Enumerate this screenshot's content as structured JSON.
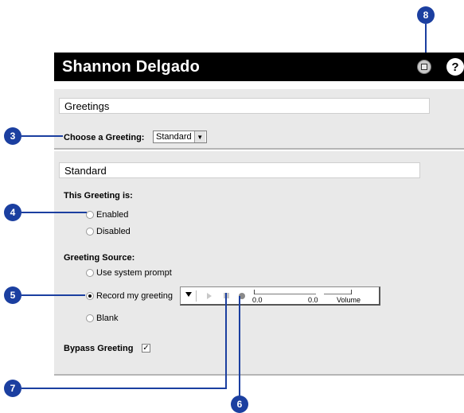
{
  "window": {
    "title": "Shannon Delgado"
  },
  "header": {
    "save_icon": "save-icon",
    "help_label": "?"
  },
  "greetings": {
    "section_title": "Greetings",
    "choose_label": "Choose a Greeting:",
    "selected_greeting": "Standard"
  },
  "standard": {
    "section_title": "Standard",
    "status_label": "This Greeting is:",
    "status_options": [
      "Enabled",
      "Disabled"
    ],
    "source_label": "Greeting Source:",
    "source_options": [
      "Use system prompt",
      "Record my greeting",
      "Blank"
    ],
    "selected_source": "Record my greeting",
    "bypass_label": "Bypass Greeting",
    "bypass_checked": true,
    "bypass_check_mark": "✓"
  },
  "recorder": {
    "position_value": "0.0",
    "duration_value": "0.0",
    "volume_label": "Volume"
  },
  "callouts": [
    "8",
    "3",
    "4",
    "5",
    "7",
    "6"
  ],
  "colors": {
    "callout": "#1b3fa0",
    "titlebar": "#000000",
    "panel": "#e9e9e9"
  }
}
